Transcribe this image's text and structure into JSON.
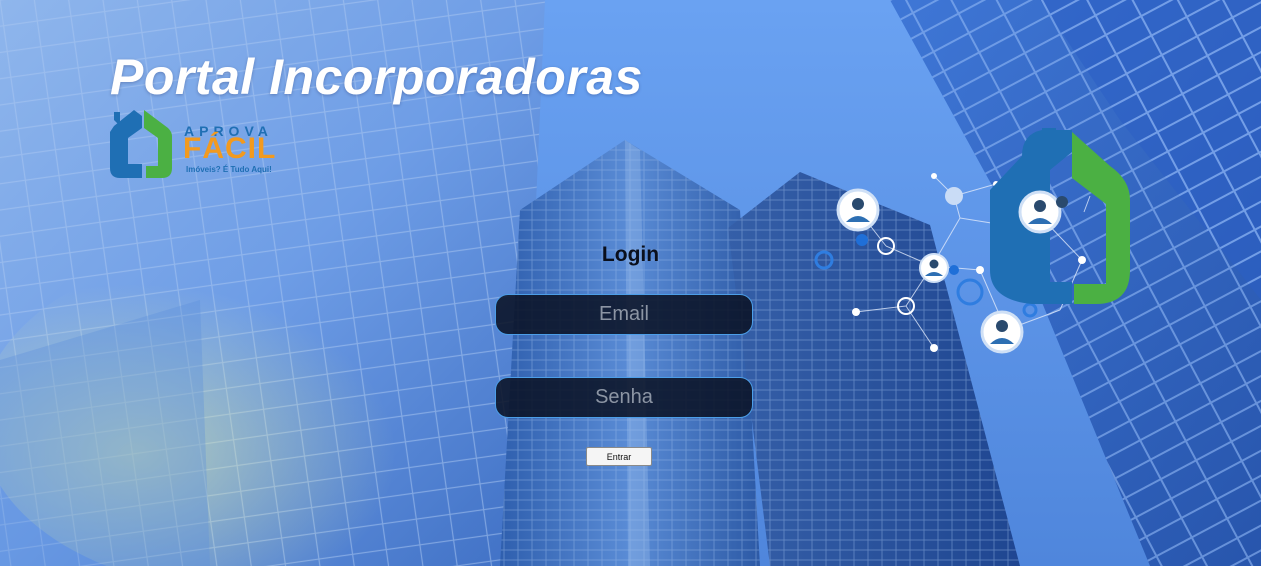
{
  "header": {
    "title": "Portal Incorporadoras"
  },
  "logo": {
    "word1": "APROVA",
    "word2": "FÁCIL",
    "tagline": "Imóveis? É Tudo Aqui!",
    "colors": {
      "blue": "#1f6fb4",
      "green": "#4bb043",
      "orange": "#f29a1f"
    }
  },
  "login": {
    "heading": "Login",
    "email_placeholder": "Email",
    "password_placeholder": "Senha",
    "submit_label": "Entrar"
  },
  "illustration": {
    "icons": [
      "user-avatar-icon",
      "support-agent-icon",
      "businessman-icon",
      "businesswoman-icon",
      "house-logo-icon"
    ]
  },
  "colors": {
    "background_sky": "#6c9ef0",
    "field_bg": "#0a1226",
    "field_border": "#4c9ee8"
  }
}
